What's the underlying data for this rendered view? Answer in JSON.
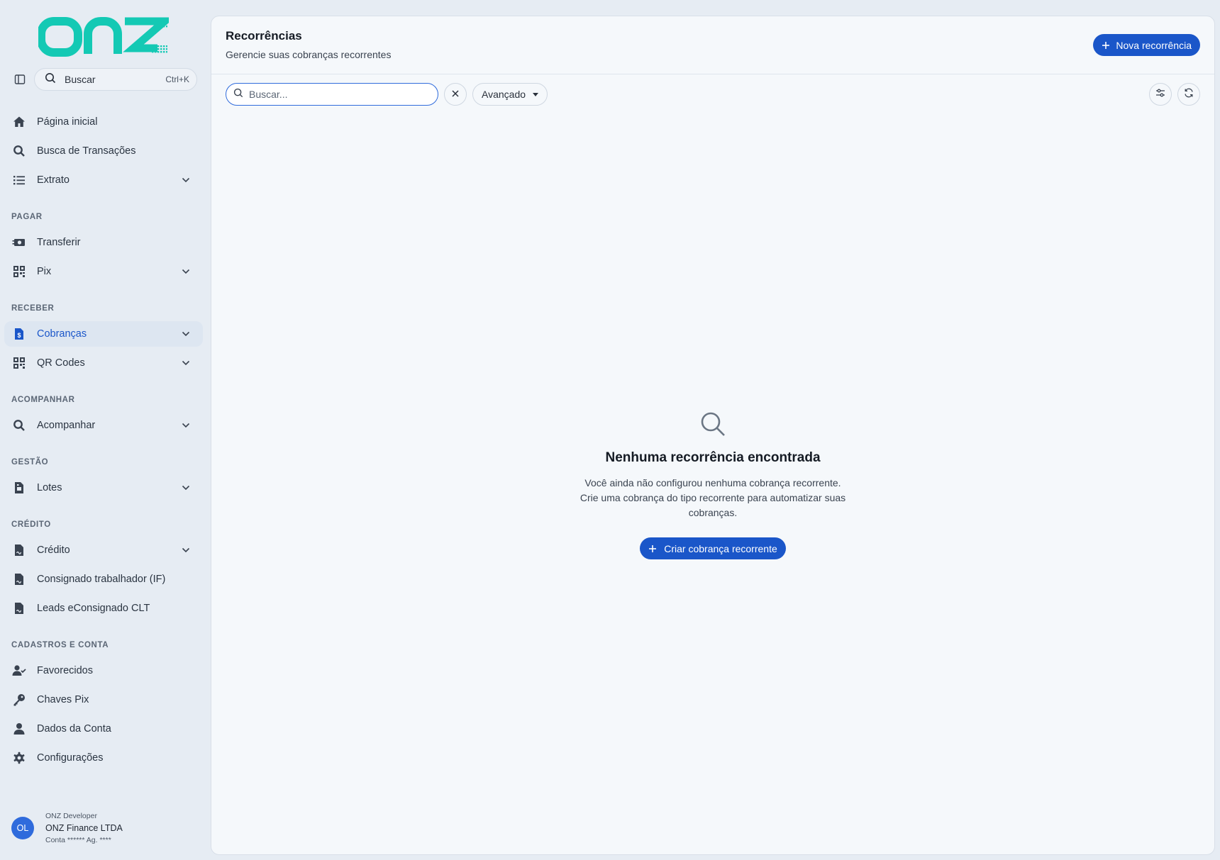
{
  "brand": {
    "logo_text": "onz",
    "accent": "#14c9b4",
    "primary": "#1a56c9"
  },
  "sidebar": {
    "search": {
      "label": "Buscar",
      "shortcut": "Ctrl+K"
    },
    "items": {
      "home": "Página inicial",
      "tx_search": "Busca de Transações",
      "extrato": "Extrato",
      "transferir": "Transferir",
      "pix": "Pix",
      "cobrancas": "Cobranças",
      "qrcodes": "QR Codes",
      "acompanhar": "Acompanhar",
      "lotes": "Lotes",
      "credito": "Crédito",
      "consignado": "Consignado trabalhador (IF)",
      "leads": "Leads eConsignado CLT",
      "favorecidos": "Favorecidos",
      "chaves": "Chaves Pix",
      "dados": "Dados da Conta",
      "config": "Configurações"
    },
    "sections": {
      "pagar": "PAGAR",
      "receber": "RECEBER",
      "acompanhar": "ACOMPANHAR",
      "gestao": "GESTÃO",
      "credito": "CRÉDITO",
      "cadastros": "CADASTROS E CONTA"
    },
    "active_item": "cobrancas",
    "user": {
      "initials": "OL",
      "role": "ONZ Developer",
      "company": "ONZ Finance LTDA",
      "account": "Conta ****** Ag. ****"
    }
  },
  "main": {
    "title": "Recorrências",
    "subtitle": "Gerencie suas cobranças recorrentes",
    "new_button": "Nova recorrência",
    "filter": {
      "placeholder": "Buscar...",
      "advanced_label": "Avançado"
    },
    "empty": {
      "title": "Nenhuma recorrência encontrada",
      "description": "Você ainda não configurou nenhuma cobrança recorrente. Crie uma cobrança do tipo recorrente para automatizar suas cobranças.",
      "button": "Criar cobrança recorrente"
    }
  }
}
